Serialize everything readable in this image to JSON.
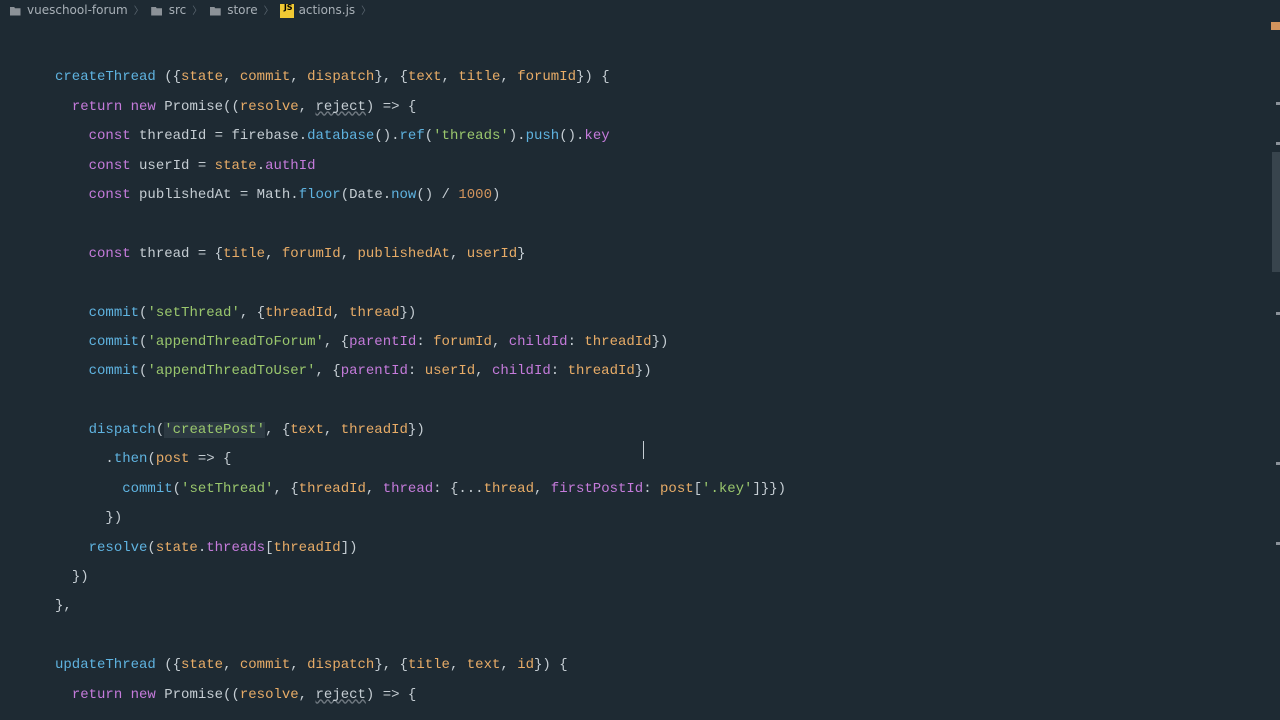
{
  "breadcrumb": {
    "project": "vueschool-forum",
    "src": "src",
    "store": "store",
    "file": "actions.js"
  },
  "code": {
    "l1_a": "createThread",
    "l1_b": " ({",
    "l1_c": "state",
    "l1_d": ", ",
    "l1_e": "commit",
    "l1_f": ", ",
    "l1_g": "dispatch",
    "l1_h": "}, {",
    "l1_i": "text",
    "l1_j": ", ",
    "l1_k": "title",
    "l1_l": ", ",
    "l1_m": "forumId",
    "l1_n": "}) {",
    "l2_a": "return new ",
    "l2_b": "Promise",
    "l2_c": "((",
    "l2_d": "resolve",
    "l2_e": ", ",
    "l2_f": "reject",
    "l2_g": ") => {",
    "l3_a": "const ",
    "l3_b": "threadId",
    "l3_c": " = ",
    "l3_d": "firebase",
    "l3_e": ".",
    "l3_f": "database",
    "l3_g": "().",
    "l3_h": "ref",
    "l3_i": "(",
    "l3_j": "'threads'",
    "l3_k": ").",
    "l3_l": "push",
    "l3_m": "().",
    "l3_n": "key",
    "l4_a": "const ",
    "l4_b": "userId",
    "l4_c": " = ",
    "l4_d": "state",
    "l4_e": ".",
    "l4_f": "authId",
    "l5_a": "const ",
    "l5_b": "publishedAt",
    "l5_c": " = ",
    "l5_d": "Math",
    "l5_e": ".",
    "l5_f": "floor",
    "l5_g": "(",
    "l5_h": "Date",
    "l5_i": ".",
    "l5_j": "now",
    "l5_k": "() / ",
    "l5_l": "1000",
    "l5_m": ")",
    "l6_a": "const ",
    "l6_b": "thread",
    "l6_c": " = {",
    "l6_d": "title",
    "l6_e": ", ",
    "l6_f": "forumId",
    "l6_g": ", ",
    "l6_h": "publishedAt",
    "l6_i": ", ",
    "l6_j": "userId",
    "l6_k": "}",
    "l7_a": "commit",
    "l7_b": "(",
    "l7_c": "'setThread'",
    "l7_d": ", {",
    "l7_e": "threadId",
    "l7_f": ", ",
    "l7_g": "thread",
    "l7_h": "})",
    "l8_a": "commit",
    "l8_b": "(",
    "l8_c": "'appendThreadToForum'",
    "l8_d": ", {",
    "l8_e": "parentId",
    "l8_f": ": ",
    "l8_g": "forumId",
    "l8_h": ", ",
    "l8_i": "childId",
    "l8_j": ": ",
    "l8_k": "threadId",
    "l8_l": "})",
    "l9_a": "commit",
    "l9_b": "(",
    "l9_c": "'appendThreadToUser'",
    "l9_d": ", {",
    "l9_e": "parentId",
    "l9_f": ": ",
    "l9_g": "userId",
    "l9_h": ", ",
    "l9_i": "childId",
    "l9_j": ": ",
    "l9_k": "threadId",
    "l9_l": "})",
    "l10_a": "dispatch",
    "l10_b": "(",
    "l10_c": "'createPost'",
    "l10_d": ", {",
    "l10_e": "text",
    "l10_f": ", ",
    "l10_g": "threadId",
    "l10_h": "})",
    "l11_a": ".",
    "l11_b": "then",
    "l11_c": "(",
    "l11_d": "post",
    "l11_e": " => {",
    "l12_a": "commit",
    "l12_b": "(",
    "l12_c": "'setThread'",
    "l12_d": ", {",
    "l12_e": "threadId",
    "l12_f": ", ",
    "l12_g": "thread",
    "l12_h": ": {...",
    "l12_i": "thread",
    "l12_j": ", ",
    "l12_k": "firstPostId",
    "l12_l": ": ",
    "l12_m": "post",
    "l12_n": "[",
    "l12_o": "'.key'",
    "l12_p": "]}})",
    "l13_a": "})",
    "l14_a": "resolve",
    "l14_b": "(",
    "l14_c": "state",
    "l14_d": ".",
    "l14_e": "threads",
    "l14_f": "[",
    "l14_g": "threadId",
    "l14_h": "])",
    "l15_a": "})",
    "l16_a": "},",
    "l17_a": "updateThread",
    "l17_b": " ({",
    "l17_c": "state",
    "l17_d": ", ",
    "l17_e": "commit",
    "l17_f": ", ",
    "l17_g": "dispatch",
    "l17_h": "}, {",
    "l17_i": "title",
    "l17_j": ", ",
    "l17_k": "text",
    "l17_l": ", ",
    "l17_m": "id",
    "l17_n": "}) {",
    "l18_a": "return new ",
    "l18_b": "Promise",
    "l18_c": "((",
    "l18_d": "resolve",
    "l18_e": ", ",
    "l18_f": "reject",
    "l18_g": ") => {"
  }
}
